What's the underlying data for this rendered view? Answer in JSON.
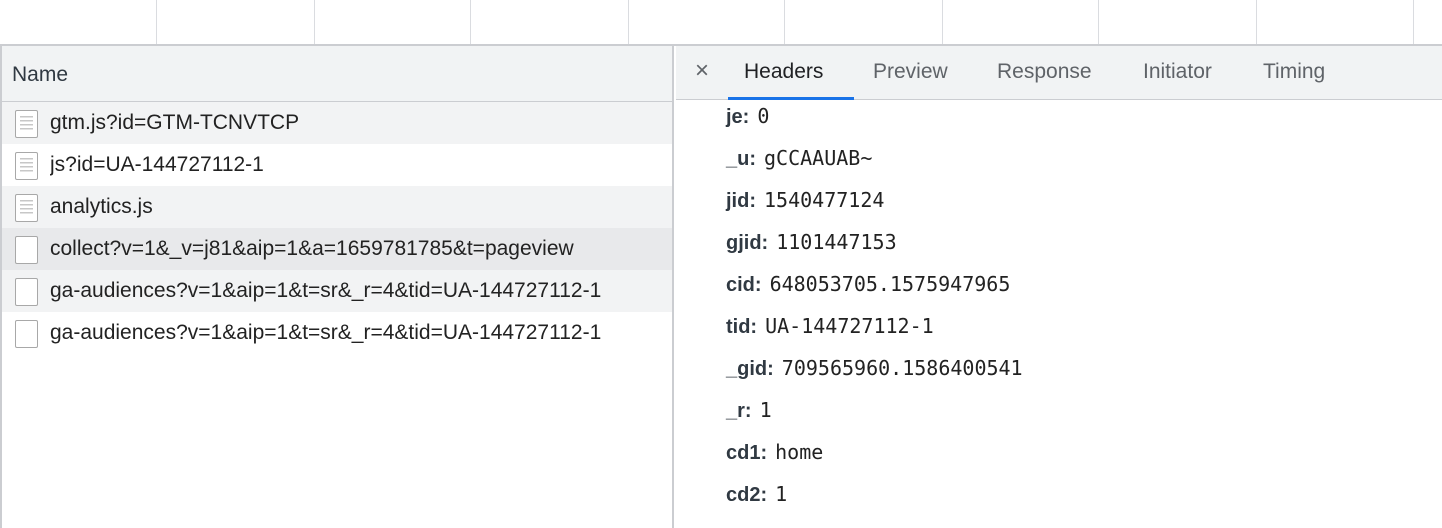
{
  "network_list": {
    "column_header": "Name",
    "requests": [
      {
        "name": "gtm.js?id=GTM-TCNVTCP",
        "icon": "script-file-icon"
      },
      {
        "name": "js?id=UA-144727112-1",
        "icon": "script-file-icon"
      },
      {
        "name": "analytics.js",
        "icon": "script-file-icon"
      },
      {
        "name": "collect?v=1&_v=j81&aip=1&a=1659781785&t=pageview",
        "icon": "blank-file-icon"
      },
      {
        "name": "ga-audiences?v=1&aip=1&t=sr&_r=4&tid=UA-144727112-1",
        "icon": "blank-file-icon"
      },
      {
        "name": "ga-audiences?v=1&aip=1&t=sr&_r=4&tid=UA-144727112-1",
        "icon": "blank-file-icon"
      }
    ]
  },
  "details": {
    "close_label": "×",
    "tabs": [
      "Headers",
      "Preview",
      "Response",
      "Initiator",
      "Timing"
    ],
    "active_tab": "Headers",
    "params": [
      {
        "key": "je:",
        "value": "0"
      },
      {
        "key": "_u:",
        "value": "gCCAAUAB~"
      },
      {
        "key": "jid:",
        "value": "1540477124"
      },
      {
        "key": "gjid:",
        "value": "1101447153"
      },
      {
        "key": "cid:",
        "value": "648053705.1575947965"
      },
      {
        "key": "tid:",
        "value": "UA-144727112-1"
      },
      {
        "key": "_gid:",
        "value": "709565960.1586400541"
      },
      {
        "key": "_r:",
        "value": "1"
      },
      {
        "key": "cd1:",
        "value": "home"
      },
      {
        "key": "cd2:",
        "value": "1"
      }
    ]
  },
  "colors": {
    "accent": "#1a73e8",
    "header_bg": "#f1f3f4",
    "border": "#cbcdd1"
  }
}
